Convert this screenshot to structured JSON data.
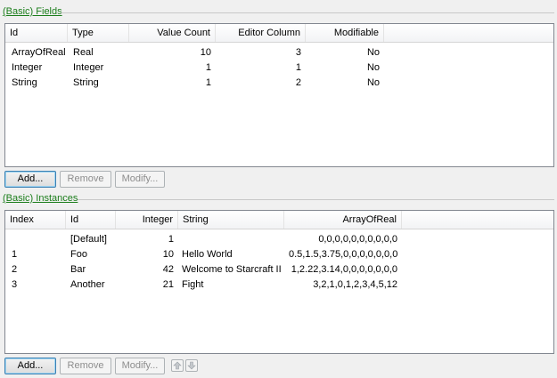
{
  "fields": {
    "title": "(Basic) Fields",
    "columns": [
      "Id",
      "Type",
      "Value Count",
      "Editor Column",
      "Modifiable"
    ],
    "rows": [
      {
        "id": "ArrayOfReal",
        "type": "Real",
        "value_count": "10",
        "editor_column": "3",
        "modifiable": "No"
      },
      {
        "id": "Integer",
        "type": "Integer",
        "value_count": "1",
        "editor_column": "1",
        "modifiable": "No"
      },
      {
        "id": "String",
        "type": "String",
        "value_count": "1",
        "editor_column": "2",
        "modifiable": "No"
      }
    ],
    "buttons": {
      "add": "Add...",
      "remove": "Remove",
      "modify": "Modify..."
    }
  },
  "instances": {
    "title": "(Basic) Instances",
    "columns": [
      "Index",
      "Id",
      "Integer",
      "String",
      "ArrayOfReal"
    ],
    "rows": [
      {
        "index": "",
        "id": "[Default]",
        "integer": "1",
        "string": "",
        "array_of_real": "0,0,0,0,0,0,0,0,0,0"
      },
      {
        "index": "1",
        "id": "Foo",
        "integer": "10",
        "string": "Hello World",
        "array_of_real": "0.5,1.5,3.75,0,0,0,0,0,0,0"
      },
      {
        "index": "2",
        "id": "Bar",
        "integer": "42",
        "string": "Welcome to Starcraft II",
        "array_of_real": "1,2.22,3.14,0,0,0,0,0,0,0"
      },
      {
        "index": "3",
        "id": "Another",
        "integer": "21",
        "string": "Fight",
        "array_of_real": "3,2,1,0,1,2,3,4,5,12"
      }
    ],
    "buttons": {
      "add": "Add...",
      "remove": "Remove",
      "modify": "Modify...",
      "move_up_icon": "arrow-up-icon",
      "move_down_icon": "arrow-down-icon"
    }
  },
  "colors": {
    "section_link": "#1a7d1a",
    "list_border": "#828790",
    "disabled_text": "#8d8d8d"
  }
}
